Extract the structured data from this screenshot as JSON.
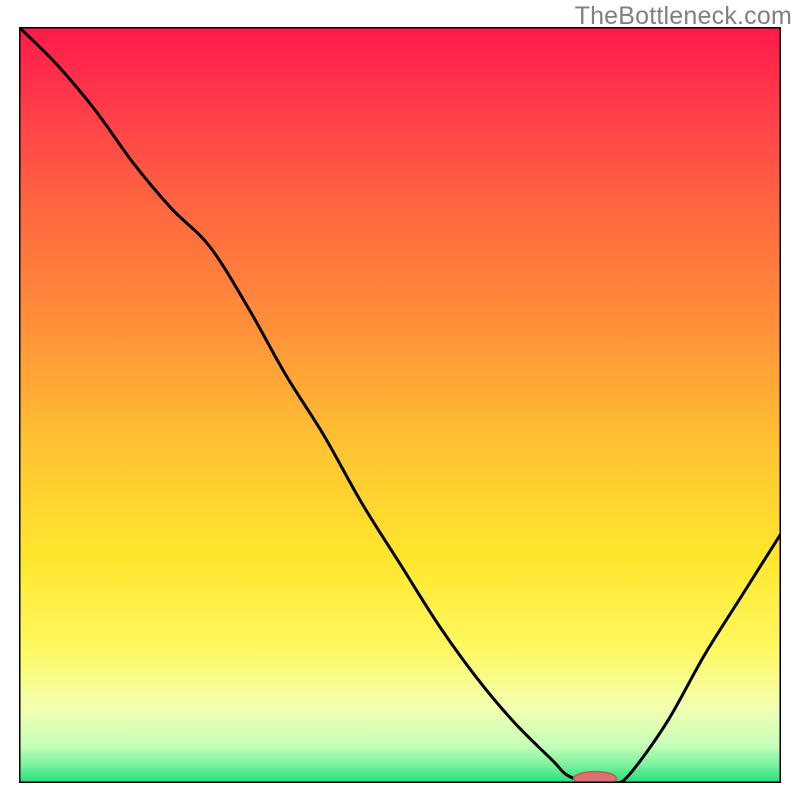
{
  "watermark": "TheBottleneck.com",
  "colors": {
    "curve": "#000000",
    "marker_fill": "#db7171",
    "marker_stroke": "#cd5656",
    "frame": "#000000",
    "gradient_stops": [
      {
        "offset": 0.0,
        "color": "#ff1a4a"
      },
      {
        "offset": 0.1,
        "color": "#ff3a4a"
      },
      {
        "offset": 0.25,
        "color": "#ff6a3f"
      },
      {
        "offset": 0.4,
        "color": "#ff913a"
      },
      {
        "offset": 0.55,
        "color": "#ffc232"
      },
      {
        "offset": 0.7,
        "color": "#ffe62d"
      },
      {
        "offset": 0.82,
        "color": "#fff85f"
      },
      {
        "offset": 0.9,
        "color": "#f3ffb0"
      },
      {
        "offset": 0.95,
        "color": "#c6ffb8"
      },
      {
        "offset": 0.975,
        "color": "#7ff3a0"
      },
      {
        "offset": 1.0,
        "color": "#1ee07a"
      }
    ]
  },
  "chart_data": {
    "type": "line",
    "title": "",
    "xlabel": "",
    "ylabel": "",
    "xlim": [
      0,
      100
    ],
    "ylim": [
      0,
      100
    ],
    "x": [
      0,
      5,
      10,
      15,
      20,
      25,
      30,
      35,
      40,
      45,
      50,
      55,
      60,
      65,
      70,
      72,
      75,
      78,
      80,
      85,
      90,
      95,
      100
    ],
    "values": [
      100,
      95,
      89,
      82,
      76,
      71,
      63,
      54,
      46,
      37,
      29,
      21,
      14,
      8,
      3,
      1,
      0,
      0,
      1,
      8,
      17,
      25,
      33
    ],
    "marker": {
      "x_center": 75.6,
      "y": 0.6,
      "rx": 2.8,
      "ry": 0.9
    },
    "background_gradient_axis": "y",
    "note": "Values are read off the plotted curve as percentage of full vertical range; x is percentage of horizontal range."
  }
}
